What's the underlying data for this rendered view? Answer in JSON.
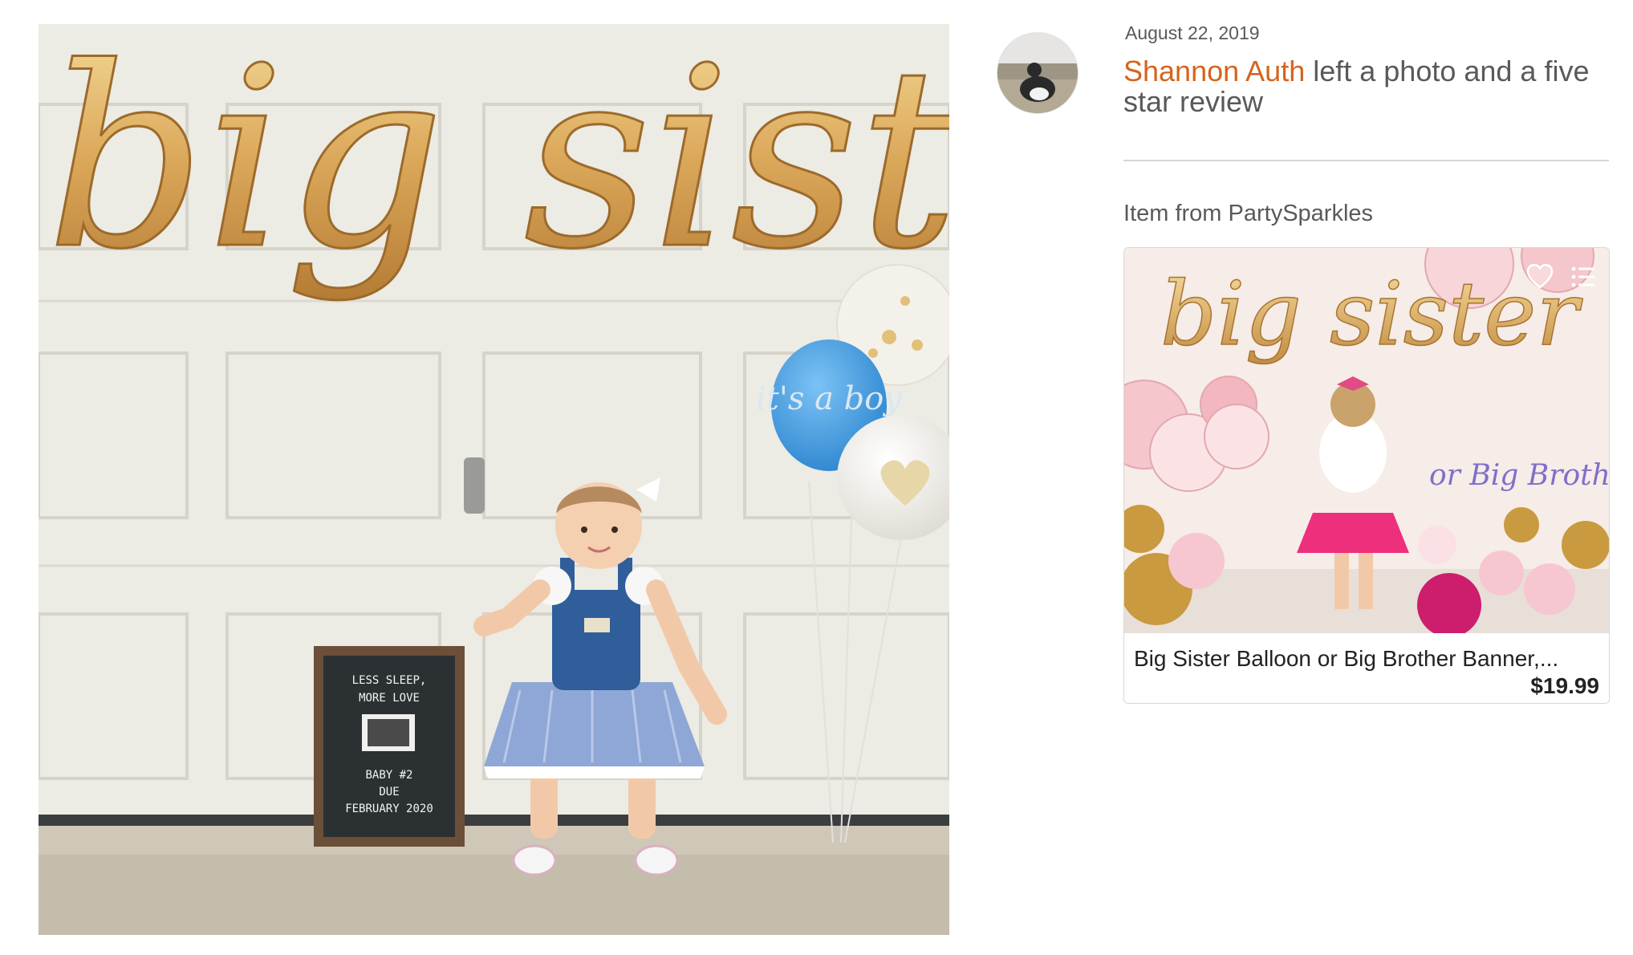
{
  "review": {
    "date": "August 22, 2019",
    "reviewer_name": "Shannon Auth",
    "action_text": " left a photo and a five star review"
  },
  "photo": {
    "balloon_text": "big sister",
    "blue_balloon_text": "it's a boy",
    "letterboard_lines": [
      "LESS SLEEP,",
      "MORE LOVE",
      "BABY #2",
      "DUE",
      "FEBRUARY 2020"
    ]
  },
  "item": {
    "label": "Item from PartySparkles",
    "title": "Big Sister Balloon or Big Brother Banner,...",
    "price": "$19.99",
    "image_balloon_text": "big sister",
    "image_sub_text": "or Big Brother",
    "favorite_icon": "heart-icon",
    "list_icon": "list-icon"
  },
  "colors": {
    "accent": "#d5641c",
    "muted_text": "#595959",
    "gold": "#d9a552",
    "price_text": "#222222"
  }
}
